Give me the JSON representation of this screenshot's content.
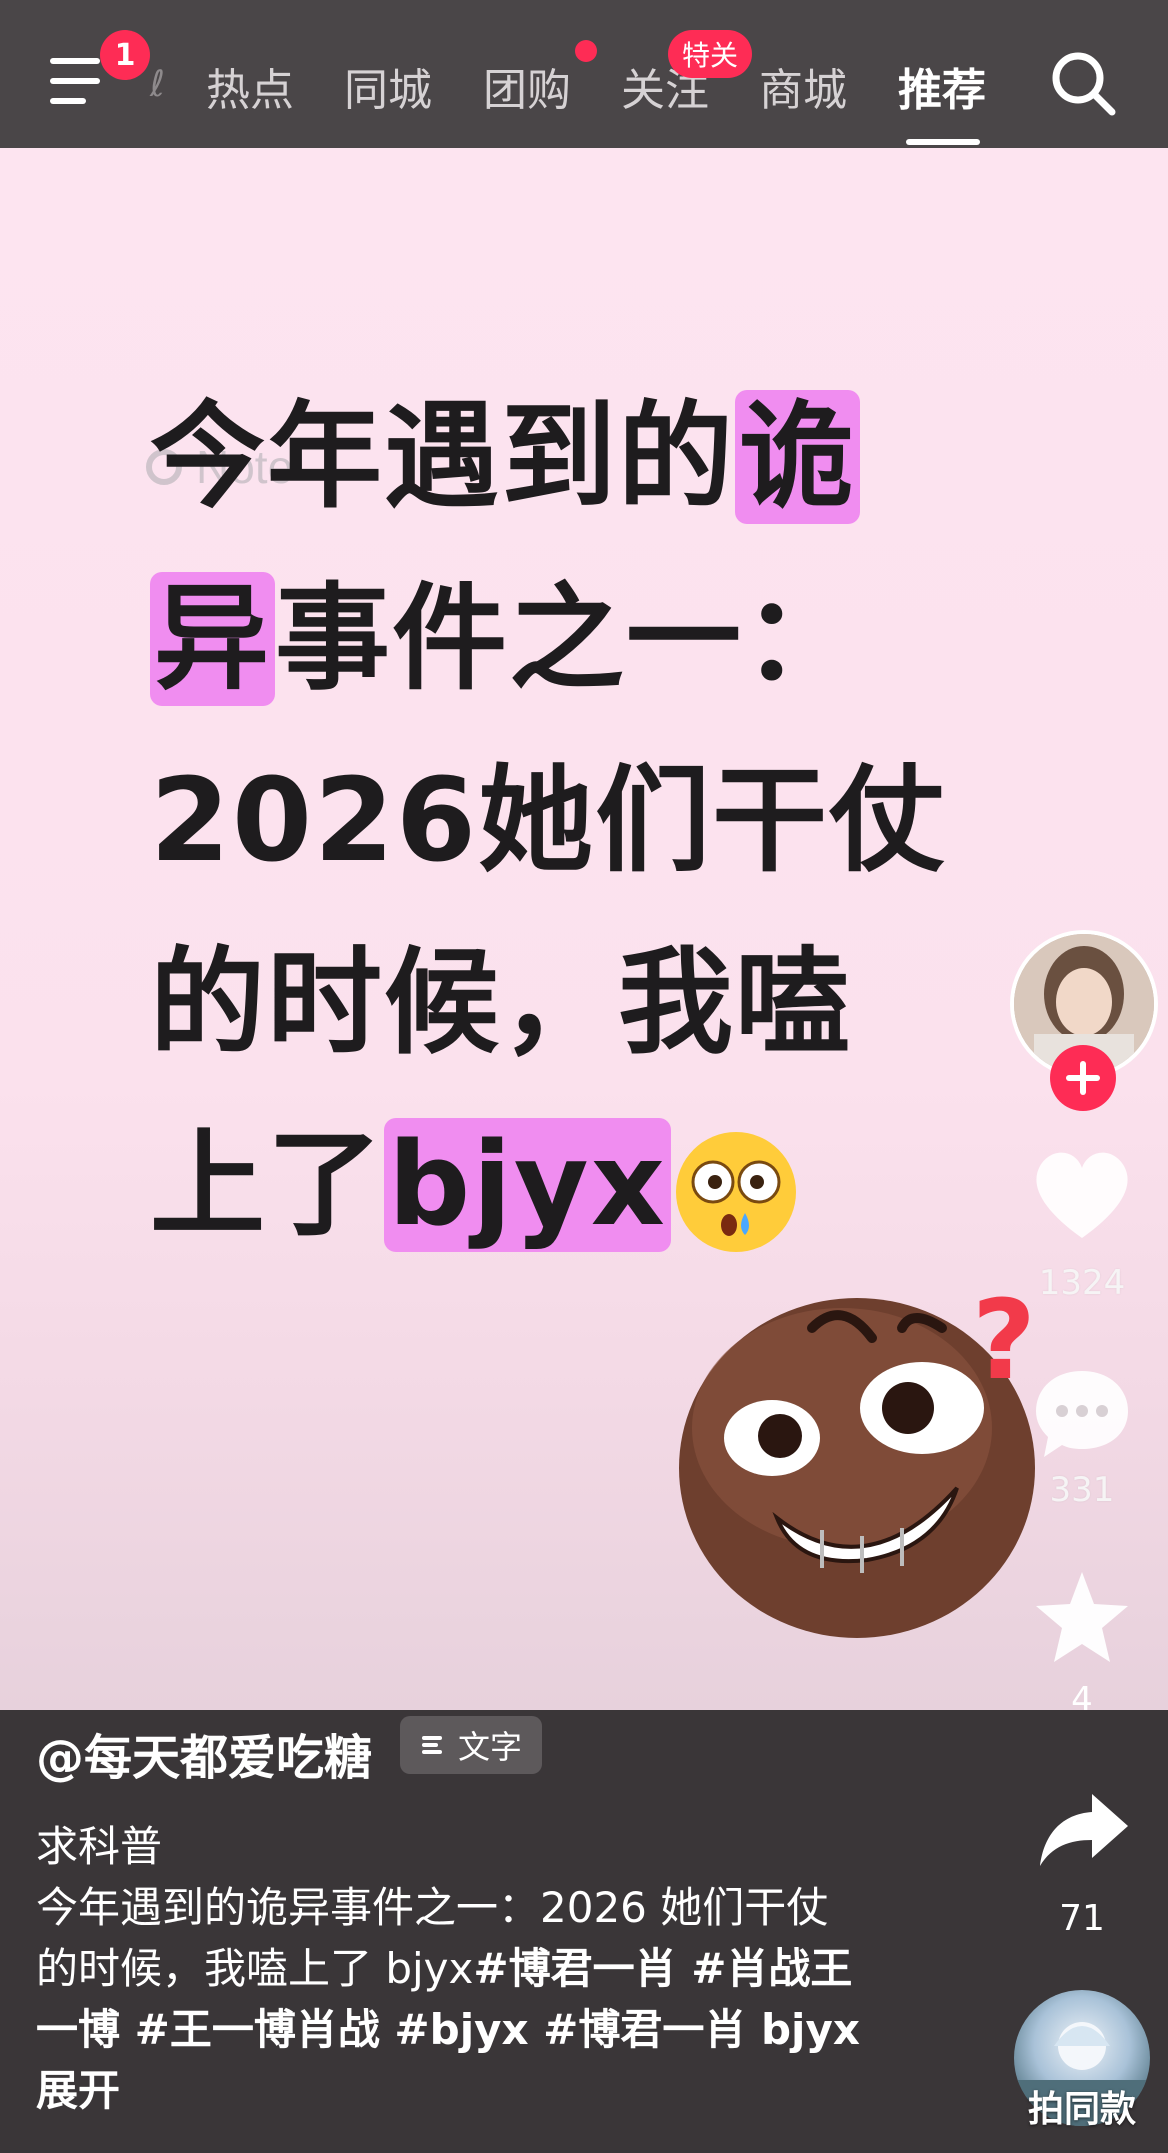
{
  "topbar": {
    "menu_badge": "1",
    "tabs": [
      "热点",
      "同城",
      "团购",
      "关注",
      "商城",
      "推荐"
    ],
    "tab_badge": "特关",
    "active_tab": "推荐"
  },
  "video": {
    "note_label": "Note",
    "headline_lines": [
      "今年遇到的",
      "诡",
      "异",
      "事件之一：",
      "2026她们干仗",
      "的时候，我嗑",
      "上了",
      "bjyx"
    ]
  },
  "rail": {
    "likes": "1324",
    "comments": "331",
    "favorites": "4",
    "shares": "71",
    "same_label": "拍同款"
  },
  "caption": {
    "author": "@每天都爱吃糖",
    "text_badge": "文字",
    "line1": "求科普",
    "line2": "今年遇到的诡异事件之一：2026 她们干仗",
    "line3_plain": "的时候，我嗑上了 bjyx",
    "line3_tags": "#博君一肖 #肖战王",
    "line4": "一博 #王一博肖战 #bjyx #博君一肖 bjyx",
    "expand": "展开"
  },
  "colors": {
    "accent": "#fe2c55",
    "highlight": "#f08df0",
    "video_bg": "#fde4f0",
    "bar_bg": "#4a4648"
  }
}
